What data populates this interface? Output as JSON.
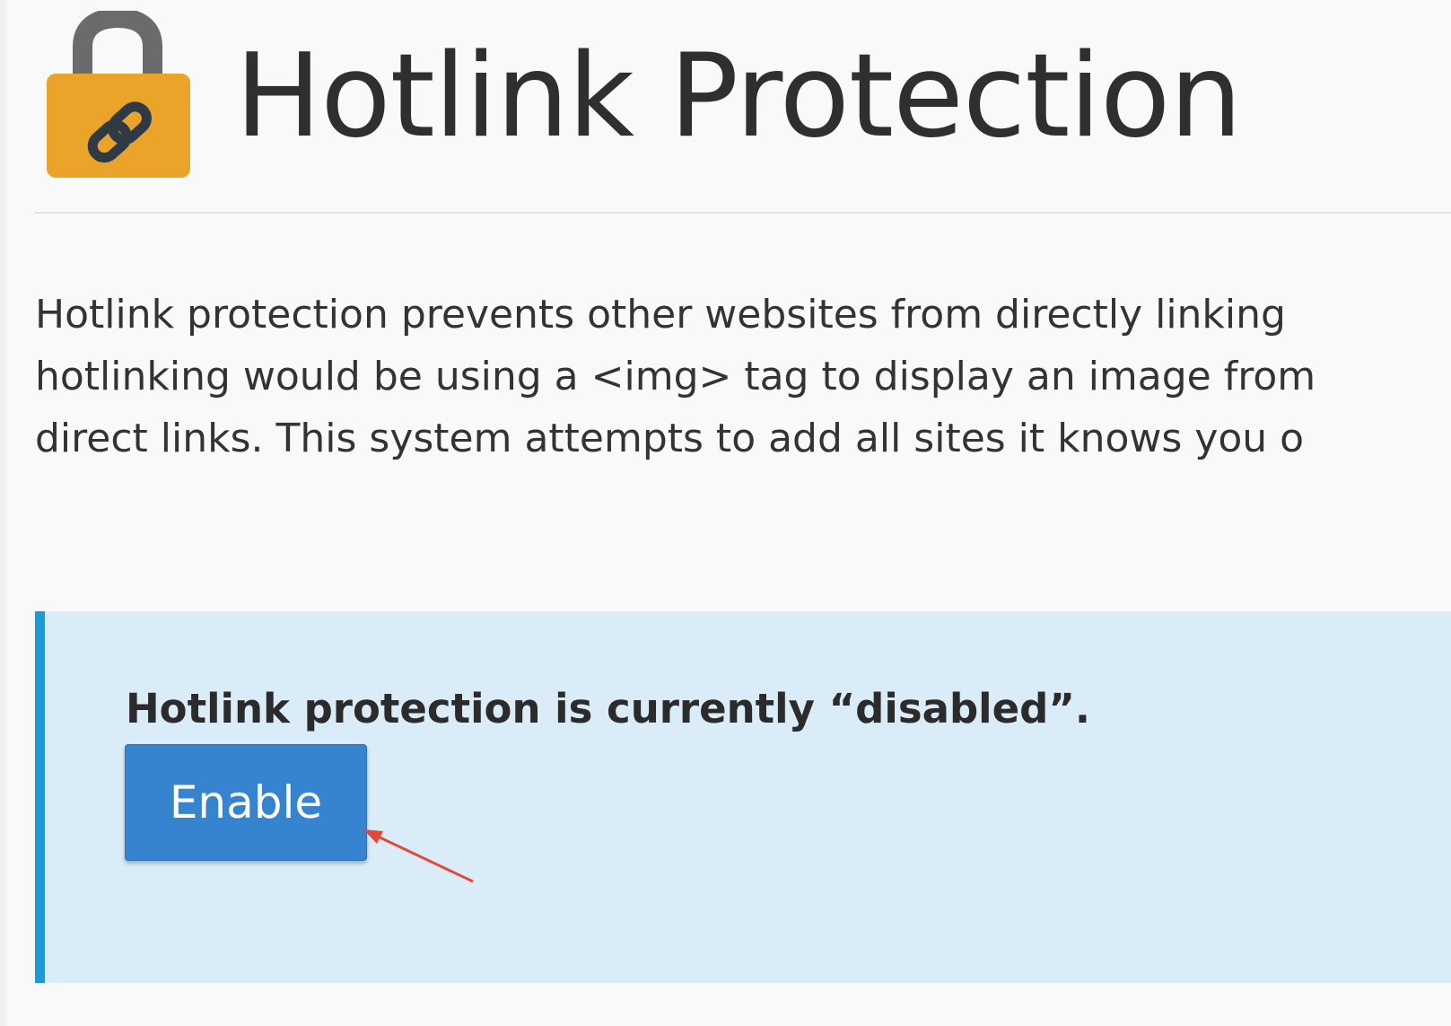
{
  "header": {
    "title": "Hotlink Protection",
    "icon": "lock-link-icon",
    "icon_colors": {
      "body": "#eba42a",
      "shackle": "#6b6b6b",
      "link": "#2f3a44"
    }
  },
  "description": {
    "lines": [
      "Hotlink protection prevents other websites from directly linking",
      "hotlinking would be using a <img> tag to display an image from",
      "direct links. This system attempts to add all sites it knows you o"
    ]
  },
  "status_panel": {
    "status_text": "Hotlink protection is currently “disabled”.",
    "enable_label": "Enable",
    "colors": {
      "background": "#d9ecf8",
      "accent": "#1a9ad8",
      "button": "#3683cf"
    }
  },
  "annotation": {
    "icon": "red-arrow-icon",
    "color": "#e04a3a"
  }
}
